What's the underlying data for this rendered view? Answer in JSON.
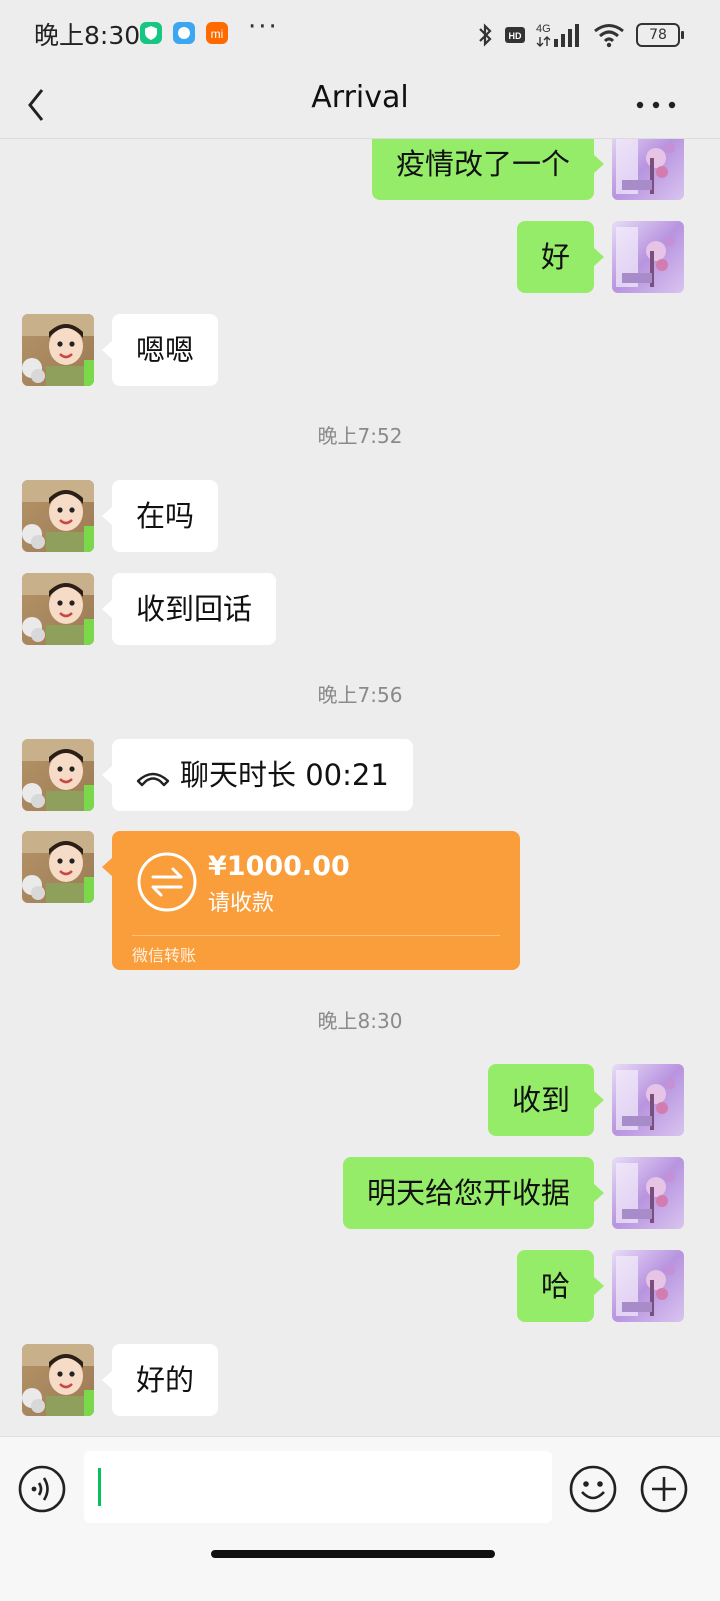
{
  "status_bar": {
    "time": "晚上8:30",
    "battery": "78",
    "network_label": "4G",
    "hd_label": "HD",
    "app_icons": [
      "shield-app-icon",
      "chat-app-icon",
      "mi-app-icon"
    ]
  },
  "header": {
    "title": "Arrival",
    "back_icon": "chevron-left-icon",
    "more_icon": "more-dots-icon"
  },
  "messages": [
    {
      "side": "right",
      "type": "text",
      "text": "疫情改了一个"
    },
    {
      "side": "right",
      "type": "text",
      "text": "好"
    },
    {
      "side": "left",
      "type": "text",
      "text": "嗯嗯"
    },
    {
      "type": "time",
      "text": "晚上7:52"
    },
    {
      "side": "left",
      "type": "text",
      "text": "在吗"
    },
    {
      "side": "left",
      "type": "text",
      "text": "收到回话"
    },
    {
      "type": "time",
      "text": "晚上7:56"
    },
    {
      "side": "left",
      "type": "call",
      "text": "聊天时长 00:21"
    },
    {
      "side": "left",
      "type": "transfer",
      "amount": "¥1000.00",
      "subtitle": "请收款",
      "footer": "微信转账"
    },
    {
      "type": "time",
      "text": "晚上8:30"
    },
    {
      "side": "right",
      "type": "text",
      "text": "收到"
    },
    {
      "side": "right",
      "type": "text",
      "text": "明天给您开收据"
    },
    {
      "side": "right",
      "type": "text",
      "text": "哈"
    },
    {
      "side": "left",
      "type": "text",
      "text": "好的"
    }
  ],
  "input_bar": {
    "voice_icon": "voice-icon",
    "emoji_icon": "emoji-icon",
    "plus_icon": "plus-icon",
    "value": ""
  },
  "colors": {
    "sent_bubble": "#95ec69",
    "received_bubble": "#ffffff",
    "transfer_card": "#fa9d3b",
    "background": "#ededed",
    "cursor": "#07c160"
  }
}
